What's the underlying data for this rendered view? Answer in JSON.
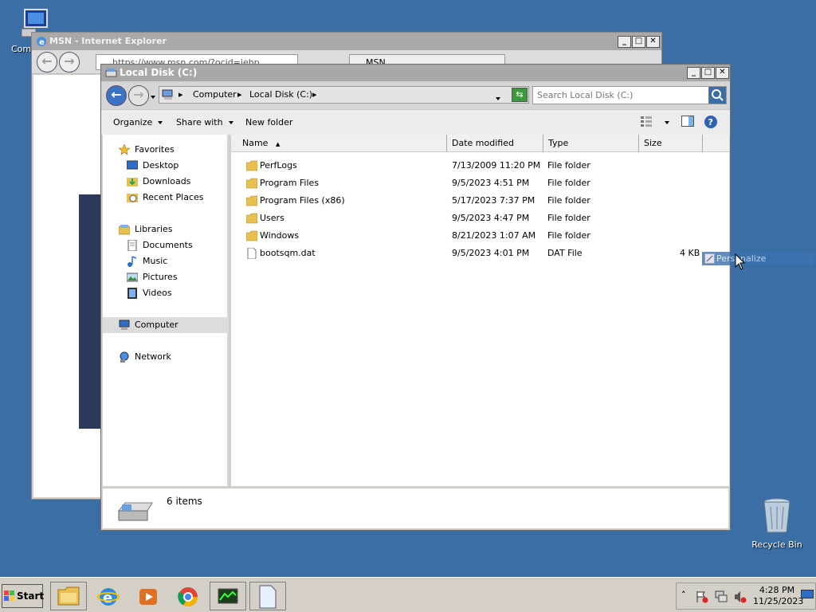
{
  "desktop": {
    "icons": [
      {
        "label": "Comp"
      },
      {
        "label": "Recycle Bin"
      }
    ]
  },
  "ie_window": {
    "title": "MSN - Internet Explorer",
    "address": "https://www.msn.com/?ocid=iehp",
    "tab_label": "MSN"
  },
  "explorer": {
    "title": "Local Disk (C:)",
    "breadcrumbs": [
      "Computer",
      "Local Disk (C:)"
    ],
    "search_placeholder": "Search Local Disk (C:)",
    "toolbar": {
      "organize": "Organize",
      "share_with": "Share with",
      "new_folder": "New folder"
    },
    "nav": {
      "favorites": "Favorites",
      "favorites_items": [
        "Desktop",
        "Downloads",
        "Recent Places"
      ],
      "libraries": "Libraries",
      "libraries_items": [
        "Documents",
        "Music",
        "Pictures",
        "Videos"
      ],
      "computer": "Computer",
      "network": "Network"
    },
    "columns": [
      "Name",
      "Date modified",
      "Type",
      "Size"
    ],
    "files": [
      {
        "name": "PerfLogs",
        "date": "7/13/2009 11:20 PM",
        "type": "File folder",
        "size": ""
      },
      {
        "name": "Program Files",
        "date": "9/5/2023 4:51 PM",
        "type": "File folder",
        "size": ""
      },
      {
        "name": "Program Files (x86)",
        "date": "5/17/2023 7:37 PM",
        "type": "File folder",
        "size": ""
      },
      {
        "name": "Users",
        "date": "9/5/2023 4:47 PM",
        "type": "File folder",
        "size": ""
      },
      {
        "name": "Windows",
        "date": "8/21/2023 1:07 AM",
        "type": "File folder",
        "size": ""
      },
      {
        "name": "bootsqm.dat",
        "date": "9/5/2023 4:01 PM",
        "type": "DAT File",
        "size": "4 KB"
      }
    ],
    "status": "6 items"
  },
  "drag_tooltip": "Personalize",
  "taskbar": {
    "start": "Start",
    "time": "4:28 PM",
    "date": "11/25/2023"
  },
  "colors": {
    "desktop": "#3a6ea5",
    "folder": "#e8c050",
    "selection": "#3b72b0"
  }
}
